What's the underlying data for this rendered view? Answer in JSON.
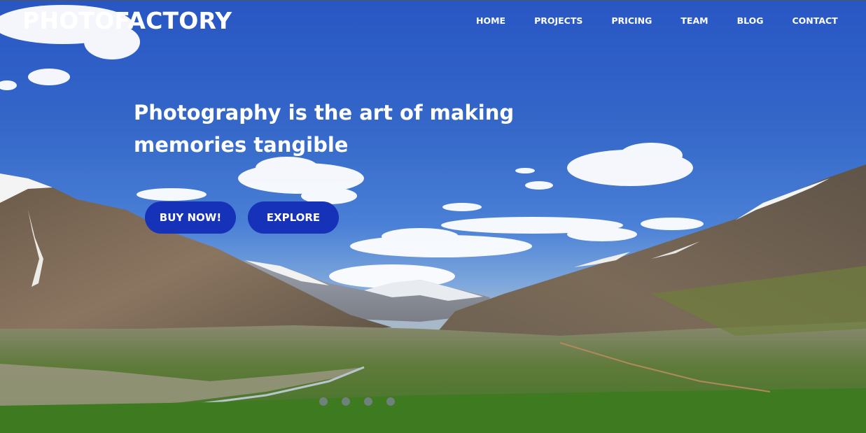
{
  "brand": {
    "name": "PHOTOFACTORY"
  },
  "nav": {
    "items": [
      {
        "label": "HOME"
      },
      {
        "label": "PROJECTS"
      },
      {
        "label": "PRICING"
      },
      {
        "label": "TEAM"
      },
      {
        "label": "BLOG"
      },
      {
        "label": "CONTACT"
      }
    ]
  },
  "hero": {
    "heading_line1": "Photography is the art of making",
    "heading_line2": "memories tangible",
    "buy_label": "BUY NOW!",
    "explore_label": "EXPLORE",
    "slides_count": 4
  },
  "colors": {
    "button": "#1632b8",
    "sky": "#2f5fc4",
    "text": "#ffffff"
  }
}
